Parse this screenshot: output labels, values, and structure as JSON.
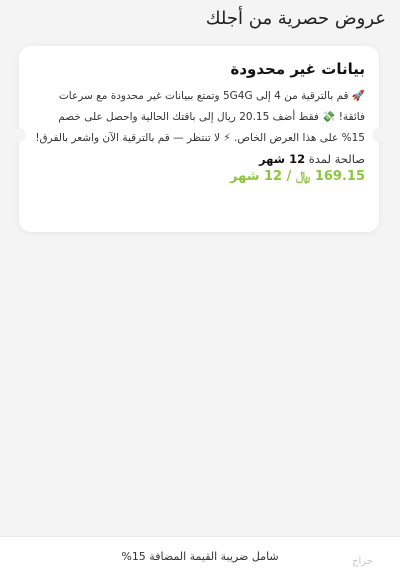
{
  "header": {
    "title": "عروض حصرية من أجلك"
  },
  "offer": {
    "title": "بيانات غير محدودة",
    "description": "🚀 قم بالترقية من 4 إلى 5G4G وتمتع ببيانات غير محدودة مع سرعات فائقة! 💸 فقط أضف 20.15 ريال إلى باقتك الحالية واحصل على خصم 15% على هذا العرض الخاص. ⚡ لا تنتظر — قم بالترقية الآن واشعر بالفرق!",
    "validity_prefix": "صالحة لمدة",
    "validity_value": "12 شهر",
    "price": "169.15 ﷼ / 12 شهر"
  },
  "footer": {
    "vat_note": "شامل ضريبة القيمة المضافة 15%"
  },
  "watermark": {
    "text": "حراج"
  }
}
